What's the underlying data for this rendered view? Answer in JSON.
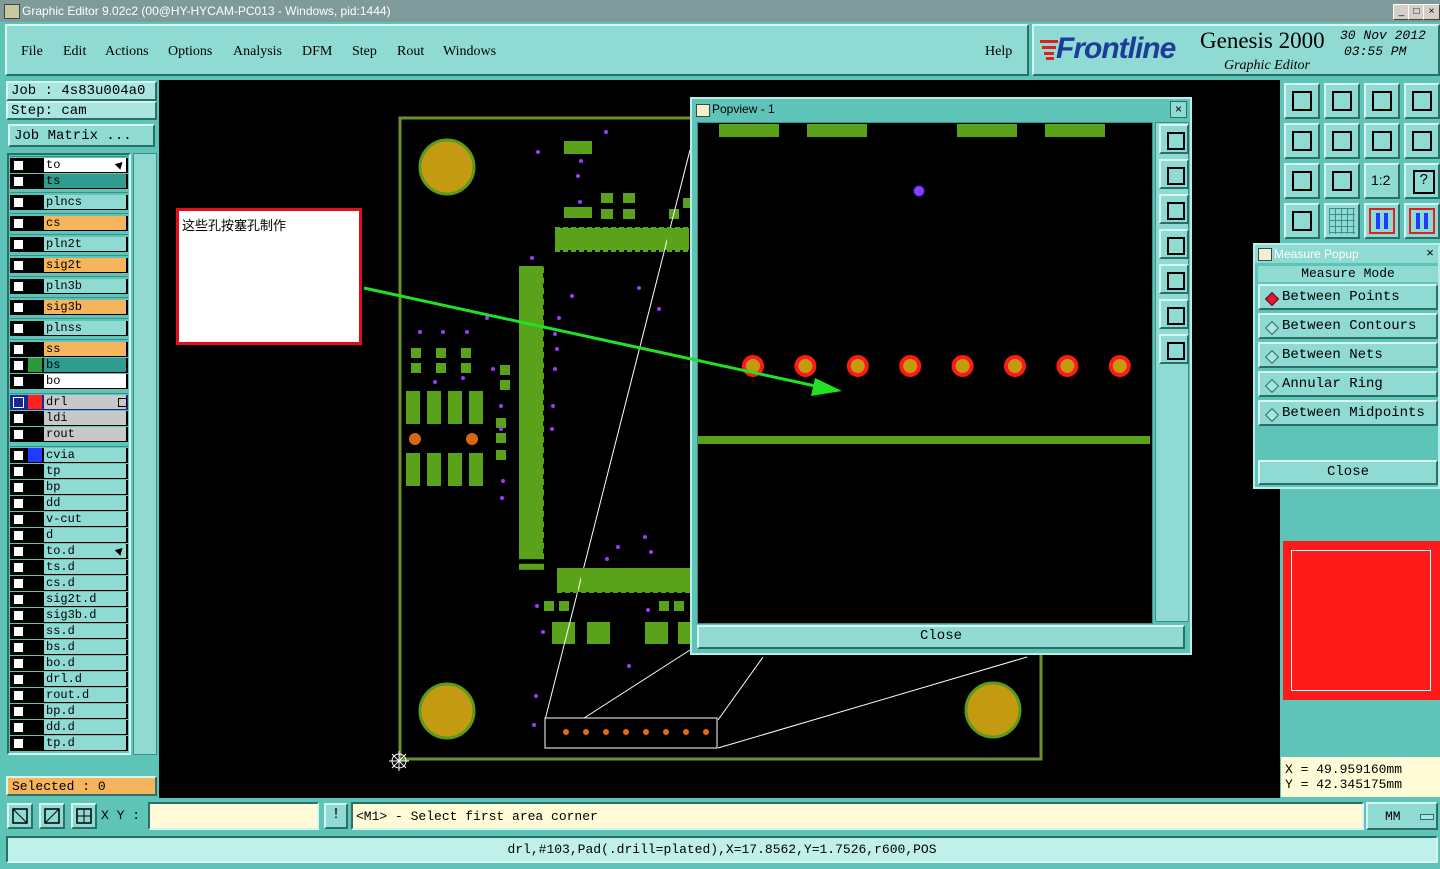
{
  "window": {
    "title": "Graphic Editor 9.02c2 (00@HY-HYCAM-PC013 - Windows, pid:1444)",
    "controls": [
      "_",
      "□",
      "×"
    ]
  },
  "menu": {
    "items": [
      "File",
      "Edit",
      "Actions",
      "Options",
      "Analysis",
      "DFM",
      "Step",
      "Rout",
      "Windows"
    ],
    "help": "Help"
  },
  "brand": {
    "logo": "Frontline",
    "product": "Genesis 2000",
    "subtitle": "Graphic Editor",
    "date": "30 Nov 2012",
    "time": "03:55 PM"
  },
  "job": {
    "job_line": "Job : 4s83u004a0",
    "step_line": "Step: cam",
    "matrix_button": "Job Matrix ..."
  },
  "layers": [
    {
      "name": "to",
      "color": "#ffffff",
      "arrow": true
    },
    {
      "name": "ts",
      "color": "#2e9c8e"
    },
    {
      "name": "plncs",
      "color": "#8fdad2"
    },
    {
      "name": "cs",
      "color": "#f6b45c"
    },
    {
      "name": "pln2t",
      "color": "#8fdad2"
    },
    {
      "name": "sig2t",
      "color": "#f6b45c"
    },
    {
      "name": "pln3b",
      "color": "#8fdad2"
    },
    {
      "name": "sig3b",
      "color": "#f6b45c"
    },
    {
      "name": "plnss",
      "color": "#8fdad2"
    },
    {
      "name": "ss",
      "color": "#f6b45c"
    },
    {
      "name": "bs",
      "color": "#2e9c8e",
      "swatch": "#2a9a3a"
    },
    {
      "name": "bo",
      "color": "#ffffff"
    },
    {
      "name": "drl",
      "color": "#c8c8c8",
      "swatch": "#ff2020",
      "active": true
    },
    {
      "name": "ldi",
      "color": "#c8c8c8"
    },
    {
      "name": "rout",
      "color": "#c8c8c8"
    },
    {
      "name": "cvia",
      "color": "#8fdad2",
      "swatch": "#1f3bff"
    },
    {
      "name": "tp",
      "color": "#8fdad2"
    },
    {
      "name": "bp",
      "color": "#8fdad2"
    },
    {
      "name": "dd",
      "color": "#8fdad2"
    },
    {
      "name": "v-cut",
      "color": "#8fdad2"
    },
    {
      "name": "d",
      "color": "#8fdad2"
    },
    {
      "name": "to.d",
      "color": "#8fdad2",
      "arrow": true
    },
    {
      "name": "ts.d",
      "color": "#8fdad2"
    },
    {
      "name": "cs.d",
      "color": "#8fdad2"
    },
    {
      "name": "sig2t.d",
      "color": "#8fdad2"
    },
    {
      "name": "sig3b.d",
      "color": "#8fdad2"
    },
    {
      "name": "ss.d",
      "color": "#8fdad2"
    },
    {
      "name": "bs.d",
      "color": "#8fdad2"
    },
    {
      "name": "bo.d",
      "color": "#8fdad2"
    },
    {
      "name": "drl.d",
      "color": "#8fdad2"
    },
    {
      "name": "rout.d",
      "color": "#8fdad2"
    },
    {
      "name": "bp.d",
      "color": "#8fdad2"
    },
    {
      "name": "dd.d",
      "color": "#8fdad2"
    },
    {
      "name": "tp.d",
      "color": "#8fdad2"
    }
  ],
  "selected": "Selected : 0",
  "annotation": "这些孔按塞孔制作",
  "popview": {
    "title": "Popview - 1",
    "close": "Close"
  },
  "measure": {
    "title": "Measure Popup",
    "header": "Measure Mode",
    "options": [
      "Between Points",
      "Between Contours",
      "Between Nets",
      "Annular Ring",
      "Between Midpoints"
    ],
    "selected_index": 0,
    "close": "Close"
  },
  "toolbox": {
    "icons": [
      "zoom-home-icon",
      "zoom-in-icon",
      "zoom-out-icon",
      "zoom-box-icon",
      "pan-left-icon",
      "pan-right-icon",
      "redraw-icon",
      "snap-icon",
      "fit-icon",
      "center-icon",
      "ratio-icon",
      "help-icon",
      "tools-icon",
      "grid-icon",
      "layers-a-icon",
      "layers-b-icon"
    ],
    "ratio_label": "1:2",
    "help_label": "?"
  },
  "coords": {
    "x": "X = 49.959160mm",
    "y": "Y = 42.345175mm"
  },
  "bottom": {
    "xy_label": "X Y :",
    "xy_value": "",
    "prompt": "<M1> - Select first area corner",
    "units": "MM",
    "feature_info": "drl,#103,Pad(.drill=plated),X=17.8562,Y=1.7526,r600,POS"
  }
}
